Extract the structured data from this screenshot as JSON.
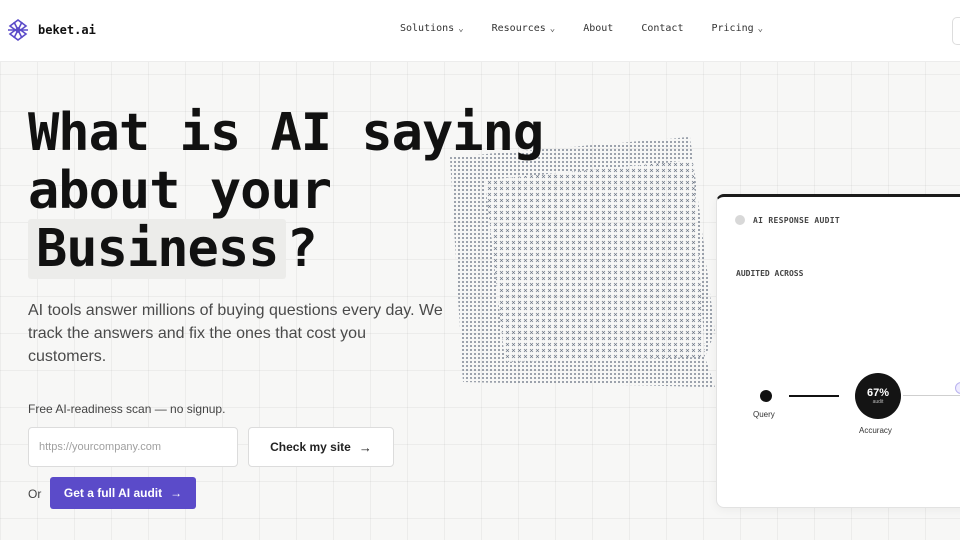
{
  "brand": {
    "name": "beket.ai",
    "logo_icon": "knot-logo-icon",
    "accent": "#5b4bc9"
  },
  "nav": {
    "items": [
      {
        "label": "Solutions",
        "dropdown": true
      },
      {
        "label": "Resources",
        "dropdown": true
      },
      {
        "label": "About",
        "dropdown": false
      },
      {
        "label": "Contact",
        "dropdown": false
      },
      {
        "label": "Pricing",
        "dropdown": true
      }
    ]
  },
  "hero": {
    "line1": "What is AI saying",
    "line2": "about your",
    "line3_highlight": "Business",
    "line3_suffix": "?",
    "subtext": "AI tools answer millions of buying questions every day. We track the answers and fix the ones that cost you customers.",
    "scan_note": "Free AI-readiness scan — no signup.",
    "url_placeholder": "https://yourcompany.com",
    "check_button": "Check my site",
    "or_label": "Or",
    "audit_button": "Get a full AI audit",
    "arrow_icon": "arrow-right-icon"
  },
  "audit_card": {
    "title": "AI RESPONSE AUDIT",
    "section_label": "AUDITED ACROSS",
    "query_label": "Query",
    "accuracy_percent": "67%",
    "accuracy_sub": "audit",
    "accuracy_label": "Accuracy"
  }
}
